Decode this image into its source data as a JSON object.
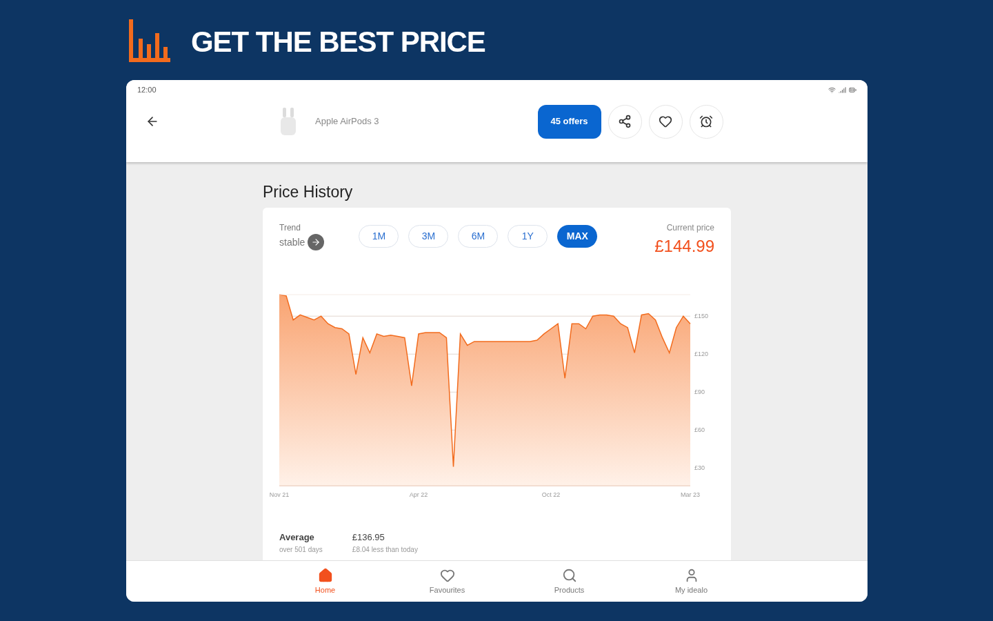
{
  "headline": "GET THE BEST PRICE",
  "status_bar": {
    "time": "12:00"
  },
  "app_bar": {
    "product_name": "Apple AirPods 3",
    "offers_button": "45 offers"
  },
  "price_history": {
    "title": "Price History",
    "trend_label": "Trend",
    "trend_value": "stable",
    "ranges": [
      {
        "label": "1M",
        "selected": false
      },
      {
        "label": "3M",
        "selected": false
      },
      {
        "label": "6M",
        "selected": false
      },
      {
        "label": "1Y",
        "selected": false
      },
      {
        "label": "MAX",
        "selected": true
      }
    ],
    "current_price_label": "Current price",
    "current_price": "£144.99",
    "chart_data": {
      "type": "area",
      "categories": [
        "Nov 21",
        null,
        null,
        null,
        null,
        null,
        null,
        null,
        null,
        null,
        null,
        null,
        null,
        null,
        null,
        null,
        null,
        null,
        null,
        null,
        "Apr 22",
        null,
        null,
        null,
        null,
        null,
        null,
        null,
        null,
        null,
        null,
        null,
        null,
        null,
        null,
        null,
        null,
        null,
        null,
        "Oct 22",
        null,
        null,
        null,
        null,
        null,
        null,
        null,
        null,
        null,
        null,
        null,
        null,
        null,
        null,
        null,
        null,
        null,
        null,
        null,
        "Mar 23"
      ],
      "series": [
        {
          "color": "#f26b1d",
          "values": [
            167,
            166,
            147,
            151,
            149,
            147,
            150,
            144,
            141,
            140,
            136,
            104,
            133,
            121,
            136,
            134,
            135,
            134,
            133,
            95,
            136,
            137,
            137,
            137,
            133,
            31,
            136,
            127,
            130,
            130,
            130,
            130,
            130,
            130,
            130,
            130,
            130,
            131,
            136,
            140,
            144,
            101,
            144,
            144,
            140,
            150,
            151,
            151,
            150,
            144,
            141,
            121,
            151,
            152,
            147,
            133,
            121,
            141,
            150,
            144
          ]
        }
      ],
      "ylim": [
        16,
        167
      ],
      "grid": true,
      "yticks": [
        {
          "value": 150,
          "label": "£150"
        },
        {
          "value": 120,
          "label": "£120"
        },
        {
          "value": 90,
          "label": "£90"
        },
        {
          "value": 60,
          "label": "£60"
        },
        {
          "value": 30,
          "label": "£30"
        }
      ]
    },
    "average_label": "Average",
    "average_period": "over 501 days",
    "average_price": "£136.95",
    "average_diff": "£8.04 less than today"
  },
  "bottom_nav": [
    {
      "label": "Home",
      "selected": true
    },
    {
      "label": "Favourites",
      "selected": false
    },
    {
      "label": "Products",
      "selected": false
    },
    {
      "label": "My idealo",
      "selected": false
    }
  ]
}
